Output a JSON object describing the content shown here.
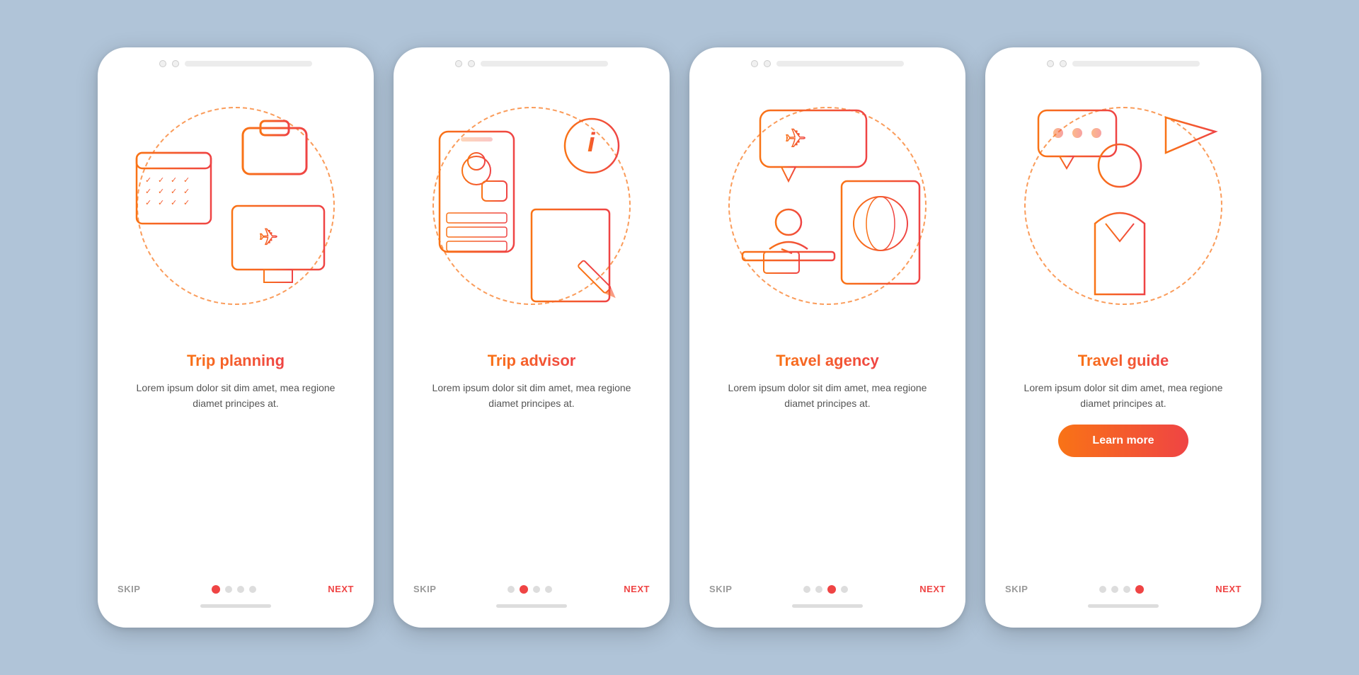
{
  "background": "#b0c4d8",
  "phones": [
    {
      "id": "trip-planning",
      "title": "Trip planning",
      "body": "Lorem ipsum dolor sit dim amet, mea regione diamet principes at.",
      "hasButton": false,
      "activeDot": 0,
      "dots": [
        true,
        false,
        false,
        false
      ],
      "skip": "SKIP",
      "next": "NEXT",
      "dashed_color": "#f97316"
    },
    {
      "id": "trip-advisor",
      "title": "Trip advisor",
      "body": "Lorem ipsum dolor sit dim amet, mea regione diamet principes at.",
      "hasButton": false,
      "activeDot": 1,
      "dots": [
        false,
        true,
        false,
        false
      ],
      "skip": "SKIP",
      "next": "NEXT",
      "dashed_color": "#f97316"
    },
    {
      "id": "travel-agency",
      "title": "Travel agency",
      "body": "Lorem ipsum dolor sit dim amet, mea regione diamet principes at.",
      "hasButton": false,
      "activeDot": 2,
      "dots": [
        false,
        false,
        true,
        false
      ],
      "skip": "SKIP",
      "next": "NEXT",
      "dashed_color": "#f97316"
    },
    {
      "id": "travel-guide",
      "title": "Travel guide",
      "body": "Lorem ipsum dolor sit dim amet, mea regione diamet principes at.",
      "hasButton": true,
      "buttonLabel": "Learn more",
      "activeDot": 3,
      "dots": [
        false,
        false,
        false,
        true
      ],
      "skip": "SKIP",
      "next": "NEXT",
      "dashed_color": "#f97316"
    }
  ]
}
